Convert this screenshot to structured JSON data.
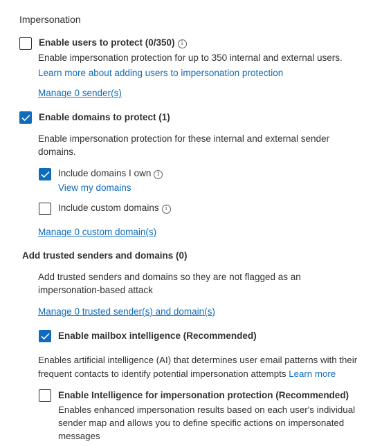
{
  "section_title": "Impersonation",
  "users": {
    "label": "Enable users to protect (0/350)",
    "checked": false,
    "description": "Enable impersonation protection for up to 350 internal and external users.",
    "learn_link": "Learn more about adding users to impersonation protection",
    "manage_link": "Manage 0 sender(s)"
  },
  "domains": {
    "label": "Enable domains to protect (1)",
    "checked": true,
    "description": "Enable impersonation protection for these internal and external sender domains.",
    "include_own": {
      "label": "Include domains I own",
      "checked": true,
      "link": "View my domains"
    },
    "include_custom": {
      "label": "Include custom domains",
      "checked": false
    },
    "manage_link": "Manage 0 custom domain(s)"
  },
  "trusted": {
    "heading": "Add trusted senders and domains (0)",
    "description": "Add trusted senders and domains so they are not flagged as an impersonation-based attack",
    "manage_link": "Manage 0 trusted sender(s) and domain(s)"
  },
  "mailbox_intelligence": {
    "label": "Enable mailbox intelligence (Recommended)",
    "checked": true,
    "description": "Enables artificial intelligence (AI) that determines user email patterns with their frequent contacts to identify potential impersonation attempts",
    "learn_more": "Learn more"
  },
  "intelligence_protection": {
    "label": "Enable Intelligence for impersonation protection (Recommended)",
    "checked": false,
    "description": "Enables enhanced impersonation results based on each user's individual sender map and allows you to define specific actions on impersonated messages"
  },
  "colors": {
    "accent": "#0f6cbd",
    "text": "#323130"
  },
  "icons": {
    "info": "info-icon",
    "check": "checkmark-icon"
  }
}
